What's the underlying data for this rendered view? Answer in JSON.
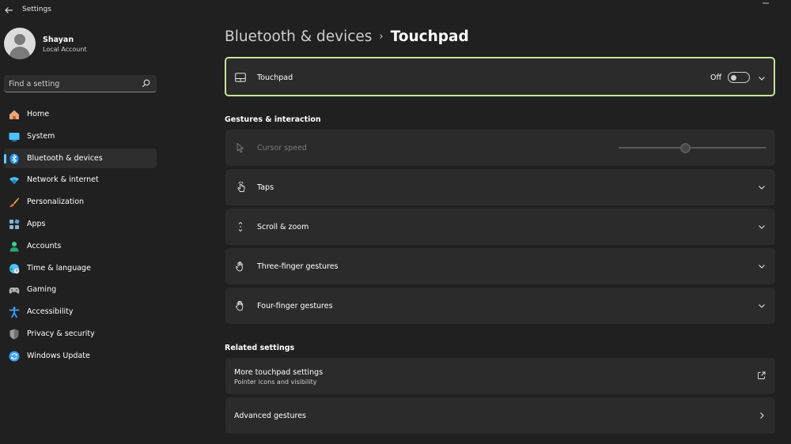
{
  "window": {
    "title": "Settings"
  },
  "profile": {
    "name": "Shayan",
    "account_type": "Local Account"
  },
  "search": {
    "placeholder": "Find a setting"
  },
  "nav": {
    "items": [
      {
        "label": "Home",
        "icon": "home-icon",
        "color": "#e8a87c"
      },
      {
        "label": "System",
        "icon": "system-icon",
        "color": "#4cc2ff"
      },
      {
        "label": "Bluetooth & devices",
        "icon": "bluetooth-icon",
        "color": "#1e90ff",
        "active": true
      },
      {
        "label": "Network & internet",
        "icon": "wifi-icon",
        "color": "#4cc2ff"
      },
      {
        "label": "Personalization",
        "icon": "brush-icon",
        "color": "#f0a030"
      },
      {
        "label": "Apps",
        "icon": "apps-icon",
        "color": "#8ab4d8"
      },
      {
        "label": "Accounts",
        "icon": "accounts-icon",
        "color": "#3ccf8e"
      },
      {
        "label": "Time & language",
        "icon": "globe-icon",
        "color": "#4cc2ff"
      },
      {
        "label": "Gaming",
        "icon": "gamepad-icon",
        "color": "#b0b0b0"
      },
      {
        "label": "Accessibility",
        "icon": "accessibility-icon",
        "color": "#3aa0ff"
      },
      {
        "label": "Privacy & security",
        "icon": "shield-icon",
        "color": "#9a9a9a"
      },
      {
        "label": "Windows Update",
        "icon": "update-icon",
        "color": "#3aa0ff"
      }
    ]
  },
  "breadcrumb": {
    "parent": "Bluetooth & devices",
    "separator": "›",
    "current": "Touchpad"
  },
  "touchpad": {
    "label": "Touchpad",
    "state_label": "Off",
    "enabled": false
  },
  "gestures": {
    "title": "Gestures & interaction",
    "cursor_speed": {
      "label": "Cursor speed",
      "value": 0.45,
      "disabled": true
    },
    "taps": {
      "label": "Taps"
    },
    "scroll_zoom": {
      "label": "Scroll & zoom"
    },
    "three_finger": {
      "label": "Three-finger gestures"
    },
    "four_finger": {
      "label": "Four-finger gestures"
    }
  },
  "related": {
    "title": "Related settings",
    "more": {
      "label": "More touchpad settings",
      "description": "Pointer icons and visibility"
    },
    "advanced": {
      "label": "Advanced gestures"
    }
  },
  "colors": {
    "accent": "#60cdff",
    "focus_border": "#c7e39a",
    "card_bg": "#2b2b2b",
    "page_bg": "#202020"
  }
}
